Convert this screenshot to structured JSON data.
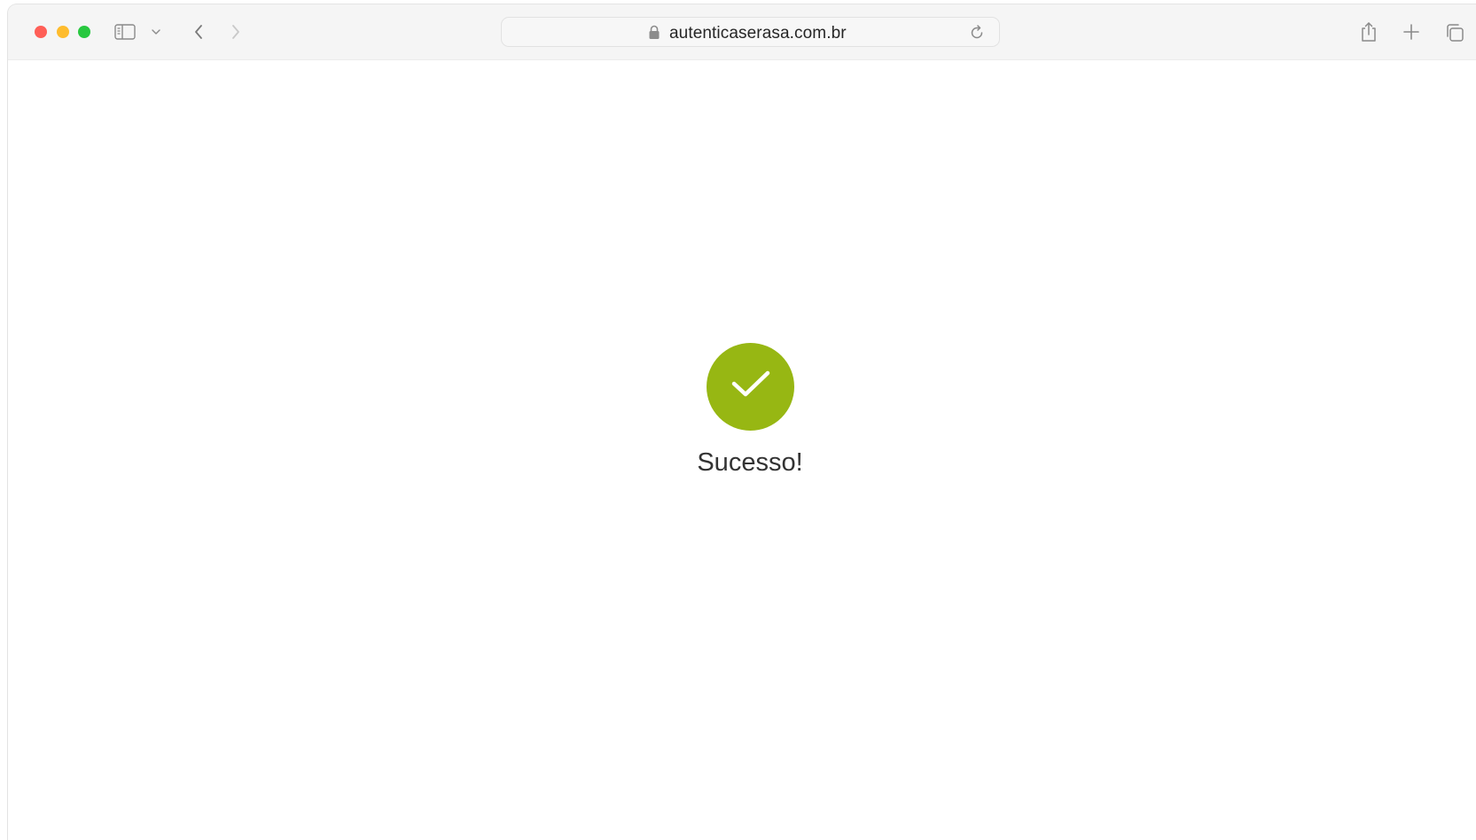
{
  "browser": {
    "url": "autenticaserasa.com.br",
    "traffic_lights": {
      "close_color": "#ff5f57",
      "minimize_color": "#febc2e",
      "maximize_color": "#28c840"
    },
    "icons": {
      "sidebar": "sidebar-icon",
      "chevron": "chevron-down-icon",
      "back": "chevron-left-icon",
      "forward": "chevron-right-icon",
      "lock": "lock-icon",
      "reload": "reload-icon",
      "share": "share-icon",
      "new_tab": "plus-icon",
      "tab_overview": "tabs-overview-icon"
    }
  },
  "page": {
    "status_icon": "checkmark-icon",
    "status_color": "#97b713",
    "message": "Sucesso!"
  }
}
